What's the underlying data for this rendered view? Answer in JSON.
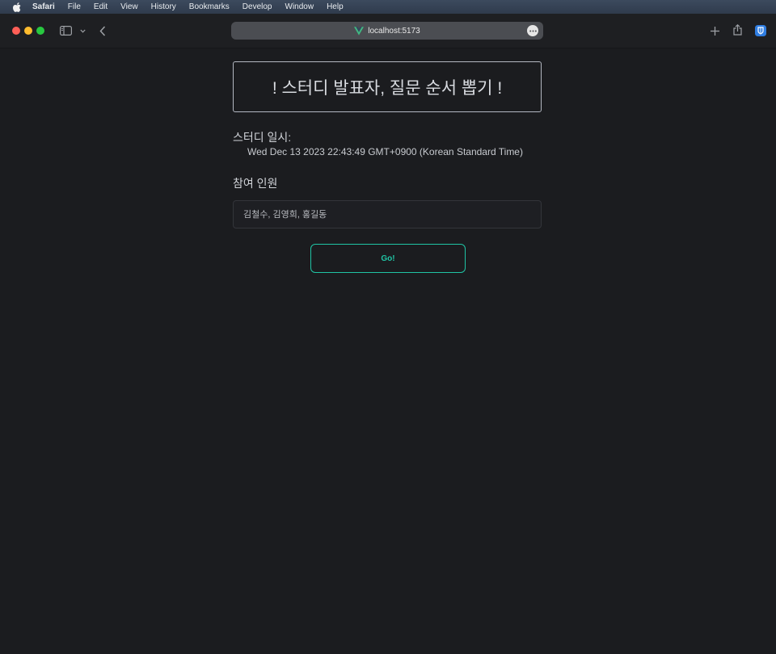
{
  "menubar": {
    "app_name": "Safari",
    "items": [
      "File",
      "Edit",
      "View",
      "History",
      "Bookmarks",
      "Develop",
      "Window",
      "Help"
    ]
  },
  "browser": {
    "url": "localhost:5173"
  },
  "page": {
    "title": "! 스터디 발표자, 질문 순서 뽑기 !",
    "date_label": "스터디 일시:",
    "date_value": "Wed Dec 13 2023 22:43:49 GMT+0900 (Korean Standard Time)",
    "members_label": "참여 인원",
    "members_placeholder": "김철수, 김영희, 홍길동",
    "members_value": "",
    "go_label": "Go!"
  },
  "colors": {
    "accent": "#20c4a4",
    "background": "#1b1c1f",
    "vue_green": "#41b883"
  }
}
